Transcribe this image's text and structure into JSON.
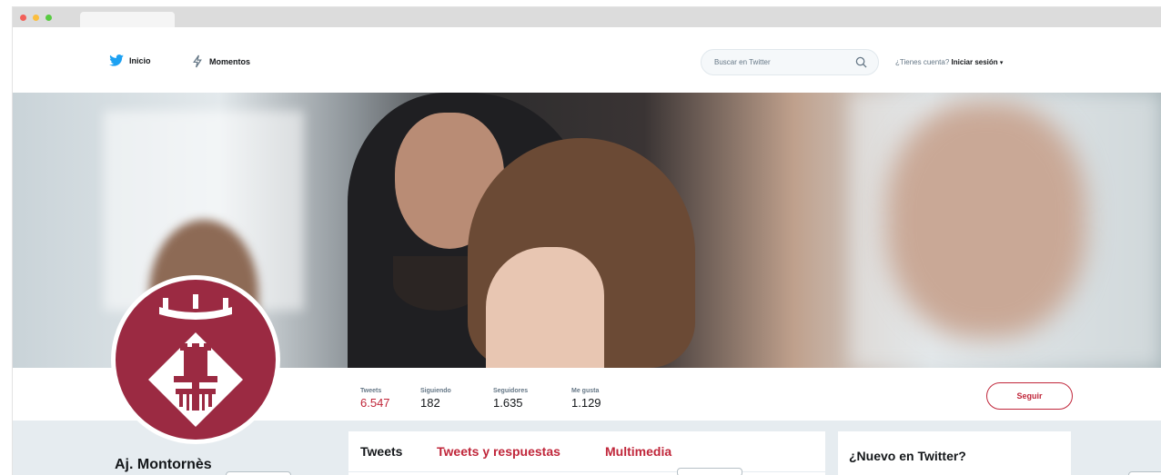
{
  "nav": {
    "home_label": "Inicio",
    "moments_label": "Momentos",
    "search_placeholder": "Buscar en Twitter",
    "login_prompt": "¿Tienes cuenta?",
    "login_label": "Iniciar sesión"
  },
  "profile": {
    "name": "Aj. Montornès",
    "follow_label": "Seguir",
    "brand_color": "#9b2a42",
    "accent_color": "#c0263a"
  },
  "stats": [
    {
      "label": "Tweets",
      "value": "6.547"
    },
    {
      "label": "Siguiendo",
      "value": "182"
    },
    {
      "label": "Seguidores",
      "value": "1.635"
    },
    {
      "label": "Me gusta",
      "value": "1.129"
    }
  ],
  "timeline": {
    "tabs": [
      "Tweets",
      "Tweets y respuestas",
      "Multimedia"
    ]
  },
  "sidebar": {
    "title": "¿Nuevo en Twitter?"
  },
  "icons": {
    "home": "twitter-bird-icon",
    "moments": "lightning-icon",
    "search": "search-icon",
    "caret": "caret-down-icon",
    "avatar_logo": "montornes-coat-of-arms-icon"
  }
}
